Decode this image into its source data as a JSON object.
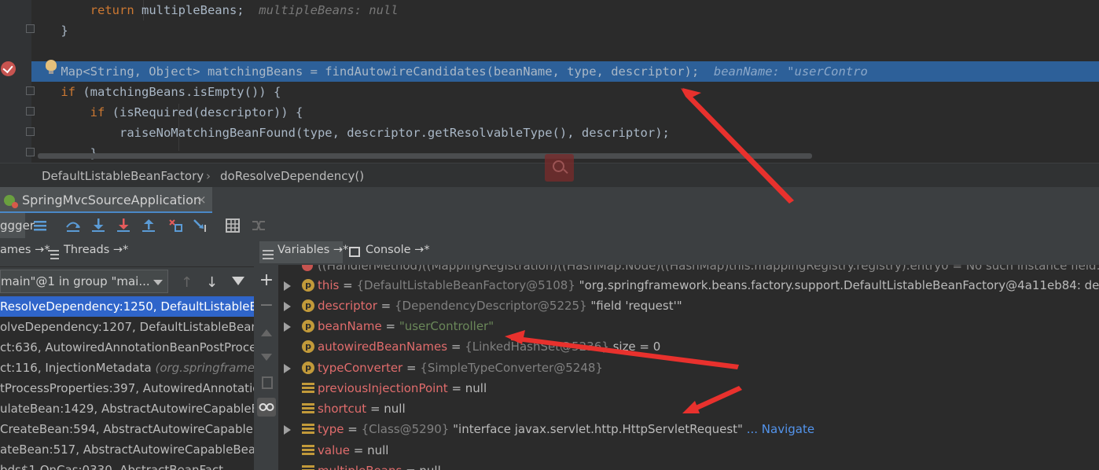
{
  "editor": {
    "lines": [
      {
        "indent": "        ",
        "kw": "return",
        "code": " multipleBeans;",
        "hint": "  multipleBeans: null"
      },
      {
        "indent": "    ",
        "code": "}"
      },
      {
        "indent": "",
        "code": ""
      },
      {
        "indent": "    ",
        "code": "Map<String, Object> matchingBeans = findAutowireCandidates(beanName, type, descriptor);",
        "hint": "  beanName: \"userContro"
      },
      {
        "indent": "    ",
        "kw": "if",
        "code": " (matchingBeans.isEmpty()) {"
      },
      {
        "indent": "        ",
        "kw": "if",
        "code": " (isRequired(descriptor)) {"
      },
      {
        "indent": "            ",
        "code": "raiseNoMatchingBeanFound(type, descriptor.getResolvableType(), descriptor);"
      },
      {
        "indent": "        ",
        "code": "}"
      }
    ]
  },
  "breadcrumb": {
    "class": "DefaultListableBeanFactory",
    "sep": "›",
    "method": "doResolveDependency()"
  },
  "run_tab": {
    "label": "SpringMvcSourceApplication",
    "close": "×"
  },
  "toolbar": {
    "debugger_label": "ggger"
  },
  "left_tabs": {
    "frames": "ames →*",
    "threads": "Threads →*"
  },
  "thread_select": {
    "value": "main\"@1 in group \"mai..."
  },
  "frames": [
    {
      "text": "ResolveDependency:1250, DefaultListableBea",
      "lib": ""
    },
    {
      "text": "olveDependency:1207, DefaultListableBeanFa",
      "lib": ""
    },
    {
      "text": "ct:636, AutowiredAnnotationBeanPostProce",
      "lib": ""
    },
    {
      "text": "ct:116, InjectionMetadata ",
      "lib": "(org.springframew"
    },
    {
      "text": "tProcessProperties:397, AutowiredAnnotatio",
      "lib": ""
    },
    {
      "text": "ulateBean:1429, AbstractAutowireCapableBe",
      "lib": ""
    },
    {
      "text": "CreateBean:594, AbstractAutowireCapableBe",
      "lib": ""
    },
    {
      "text": "ateBean:517, AbstractAutowireCapableBeanF",
      "lib": ""
    },
    {
      "text": "bds$1.OnCas:0330, AbstractBeanFact",
      "lib": ""
    }
  ],
  "var_tabs": {
    "variables": "Variables →*",
    "console": "Console →*"
  },
  "variables": [
    {
      "expand": true,
      "icon": "p",
      "name": "this",
      "eq": " = ",
      "type": "{DefaultListableBeanFactory@5108}",
      "value": " \"org.springframework.beans.factory.support.DefaultListableBeanFactory@4a11eb84: defining b",
      "str": ""
    },
    {
      "expand": true,
      "icon": "p",
      "name": "descriptor",
      "eq": " = ",
      "type": "{DependencyDescriptor@5225}",
      "value": " \"field 'request'\"",
      "str": ""
    },
    {
      "expand": true,
      "icon": "p",
      "name": "beanName",
      "eq": " = ",
      "type": "",
      "value": "",
      "str": "\"userController\""
    },
    {
      "expand": false,
      "icon": "p",
      "name": "autowiredBeanNames",
      "eq": " = ",
      "type": "{LinkedHashSet@5236}",
      "value": "  size = 0",
      "str": ""
    },
    {
      "expand": true,
      "icon": "p",
      "name": "typeConverter",
      "eq": " = ",
      "type": "{SimpleTypeConverter@5248}",
      "value": "",
      "str": ""
    },
    {
      "expand": false,
      "icon": "f",
      "name": "previousInjectionPoint",
      "eq": " = ",
      "type": "",
      "value": "null",
      "str": ""
    },
    {
      "expand": false,
      "icon": "f",
      "name": "shortcut",
      "eq": " = ",
      "type": "",
      "value": "null",
      "str": ""
    },
    {
      "expand": true,
      "icon": "f",
      "name": "type",
      "eq": " = ",
      "type": "{Class@5290}",
      "value": " \"interface javax.servlet.http.HttpServletRequest\"",
      "str": "",
      "link": " ... Navigate"
    },
    {
      "expand": false,
      "icon": "f",
      "name": "value",
      "eq": " = ",
      "type": "",
      "value": "null",
      "str": ""
    },
    {
      "expand": false,
      "icon": "f",
      "name": "multipleBeans",
      "eq": " = ",
      "type": "",
      "value": "null",
      "str": ""
    }
  ],
  "top_partial_var": "((HandlerMethod)((MappingRegistration)((HashMap.Node)((HashMap)this.mappingRegistry.registry).entry0 = No such instance field: 'ma",
  "colors": {
    "selection": "#2d6099",
    "frame_selected": "#2f65ca",
    "arrow": "#e8312d",
    "keyword": "#cc7832",
    "var_name": "#e06c6c",
    "string": "#6a8759"
  }
}
